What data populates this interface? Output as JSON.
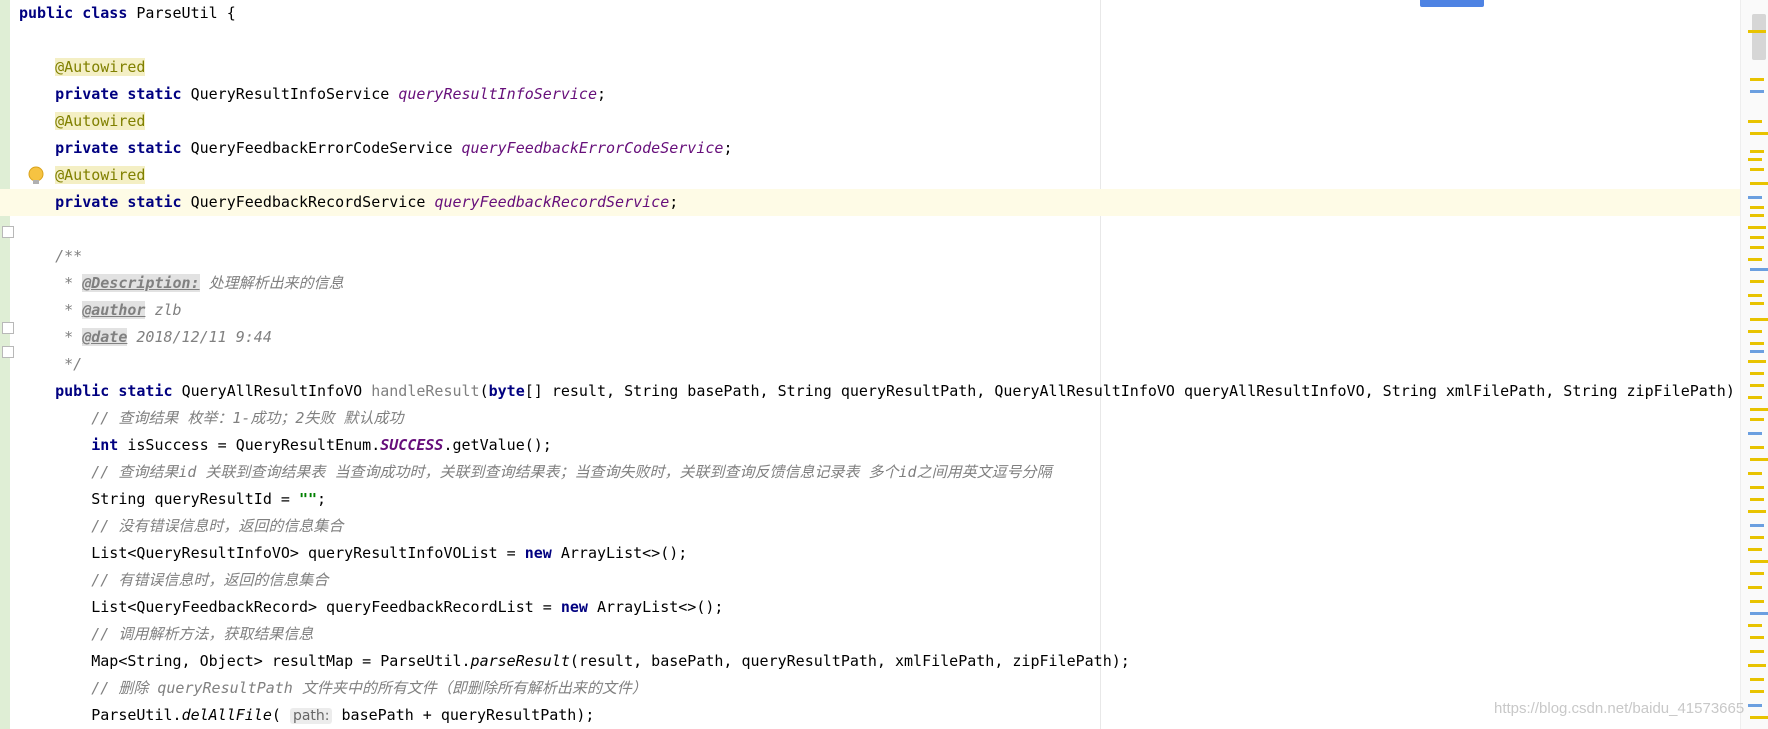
{
  "editor": {
    "lines": [
      {
        "segments": [
          {
            "t": "public class ",
            "c": "kw"
          },
          {
            "t": "ParseUtil {",
            "c": ""
          }
        ]
      },
      {
        "segments": []
      },
      {
        "segments": [
          {
            "t": "    ",
            "c": ""
          },
          {
            "t": "@Autowired",
            "c": "ann"
          }
        ]
      },
      {
        "segments": [
          {
            "t": "    ",
            "c": ""
          },
          {
            "t": "private static ",
            "c": "kw"
          },
          {
            "t": "QueryResultInfoService ",
            "c": ""
          },
          {
            "t": "queryResultInfoService",
            "c": "field"
          },
          {
            "t": ";",
            "c": ""
          }
        ]
      },
      {
        "segments": [
          {
            "t": "    ",
            "c": ""
          },
          {
            "t": "@Autowired",
            "c": "ann"
          }
        ]
      },
      {
        "segments": [
          {
            "t": "    ",
            "c": ""
          },
          {
            "t": "private static ",
            "c": "kw"
          },
          {
            "t": "QueryFeedbackErrorCodeService ",
            "c": ""
          },
          {
            "t": "queryFeedbackErrorCodeService",
            "c": "field"
          },
          {
            "t": ";",
            "c": ""
          }
        ]
      },
      {
        "segments": [
          {
            "t": "    ",
            "c": ""
          },
          {
            "t": "@Autowired",
            "c": "ann"
          }
        ]
      },
      {
        "segments": [
          {
            "t": "    ",
            "c": ""
          },
          {
            "t": "private static ",
            "c": "kw"
          },
          {
            "t": "QueryFeedbackRecordService ",
            "c": ""
          },
          {
            "t": "queryFeedbackRecordService",
            "c": "field"
          },
          {
            "t": ";",
            "c": ""
          }
        ]
      },
      {
        "segments": []
      },
      {
        "segments": [
          {
            "t": "    ",
            "c": ""
          },
          {
            "t": "/**",
            "c": "cmt"
          }
        ]
      },
      {
        "segments": [
          {
            "t": "     * ",
            "c": "cmt"
          },
          {
            "t": "@Description:",
            "c": "doctag"
          },
          {
            "t": " 处理解析出来的信息",
            "c": "cmt"
          }
        ]
      },
      {
        "segments": [
          {
            "t": "     * ",
            "c": "cmt"
          },
          {
            "t": "@author",
            "c": "doctag"
          },
          {
            "t": " zlb",
            "c": "cmt"
          }
        ]
      },
      {
        "segments": [
          {
            "t": "     * ",
            "c": "cmt"
          },
          {
            "t": "@date",
            "c": "doctag"
          },
          {
            "t": " 2018/12/11 9:44",
            "c": "cmt"
          }
        ]
      },
      {
        "segments": [
          {
            "t": "     */",
            "c": "cmt"
          }
        ]
      },
      {
        "segments": [
          {
            "t": "    ",
            "c": ""
          },
          {
            "t": "public static ",
            "c": "kw"
          },
          {
            "t": "QueryAllResultInfoVO ",
            "c": ""
          },
          {
            "t": "handleResult",
            "c": "cmt-plain"
          },
          {
            "t": "(",
            "c": ""
          },
          {
            "t": "byte",
            "c": "kw"
          },
          {
            "t": "[] result, String basePath, String queryResultPath, QueryAllResultInfoVO queryAllResultInfoVO, String xmlFilePath, String zipFilePath) {",
            "c": ""
          }
        ]
      },
      {
        "segments": [
          {
            "t": "        ",
            "c": ""
          },
          {
            "t": "// 查询结果 枚举：1-成功；2失败 默认成功",
            "c": "cmt"
          }
        ]
      },
      {
        "segments": [
          {
            "t": "        ",
            "c": ""
          },
          {
            "t": "int ",
            "c": "kw"
          },
          {
            "t": "isSuccess = QueryResultEnum.",
            "c": ""
          },
          {
            "t": "SUCCESS",
            "c": "static-field"
          },
          {
            "t": ".getValue();",
            "c": ""
          }
        ]
      },
      {
        "segments": [
          {
            "t": "        ",
            "c": ""
          },
          {
            "t": "// 查询结果id 关联到查询结果表 当查询成功时，关联到查询结果表；当查询失败时，关联到查询反馈信息记录表 多个id之间用英文逗号分隔",
            "c": "cmt"
          }
        ]
      },
      {
        "segments": [
          {
            "t": "        ",
            "c": ""
          },
          {
            "t": "String queryResultId = ",
            "c": ""
          },
          {
            "t": "\"\"",
            "c": "str"
          },
          {
            "t": ";",
            "c": ""
          }
        ]
      },
      {
        "segments": [
          {
            "t": "        ",
            "c": ""
          },
          {
            "t": "// 没有错误信息时，返回的信息集合",
            "c": "cmt"
          }
        ]
      },
      {
        "segments": [
          {
            "t": "        ",
            "c": ""
          },
          {
            "t": "List<QueryResultInfoVO> queryResultInfoVOList = ",
            "c": ""
          },
          {
            "t": "new ",
            "c": "kw"
          },
          {
            "t": "ArrayList<>();",
            "c": ""
          }
        ]
      },
      {
        "segments": [
          {
            "t": "        ",
            "c": ""
          },
          {
            "t": "// 有错误信息时，返回的信息集合",
            "c": "cmt"
          }
        ]
      },
      {
        "segments": [
          {
            "t": "        ",
            "c": ""
          },
          {
            "t": "List<QueryFeedbackRecord> queryFeedbackRecordList = ",
            "c": ""
          },
          {
            "t": "new ",
            "c": "kw"
          },
          {
            "t": "ArrayList<>();",
            "c": ""
          }
        ]
      },
      {
        "segments": [
          {
            "t": "        ",
            "c": ""
          },
          {
            "t": "// 调用解析方法，获取结果信息",
            "c": "cmt"
          }
        ]
      },
      {
        "segments": [
          {
            "t": "        ",
            "c": ""
          },
          {
            "t": "Map<String, Object> resultMap = ParseUtil.",
            "c": ""
          },
          {
            "t": "parseResult",
            "c": "static-call"
          },
          {
            "t": "(result, basePath, queryResultPath, xmlFilePath, zipFilePath);",
            "c": ""
          }
        ]
      },
      {
        "segments": [
          {
            "t": "        ",
            "c": ""
          },
          {
            "t": "// 删除 queryResultPath 文件夹中的所有文件（即删除所有解析出来的文件）",
            "c": "cmt"
          }
        ]
      },
      {
        "segments": [
          {
            "t": "        ",
            "c": ""
          },
          {
            "t": "ParseUtil.",
            "c": ""
          },
          {
            "t": "delAllFile",
            "c": "static-call"
          },
          {
            "t": "( ",
            "c": ""
          },
          {
            "t": "path:",
            "c": "param-hint"
          },
          {
            "t": " basePath + queryResultPath);",
            "c": ""
          }
        ]
      }
    ]
  },
  "watermark": "https://blog.csdn.net/baidu_41573665",
  "colors": {
    "gutter": "#dfeed5",
    "current_line": "#fefbe6",
    "keyword": "#000080",
    "comment": "#808080",
    "field": "#660e7a",
    "string": "#008000",
    "marker_yellow": "#e8c300",
    "marker_blue": "#6b9fe0"
  }
}
